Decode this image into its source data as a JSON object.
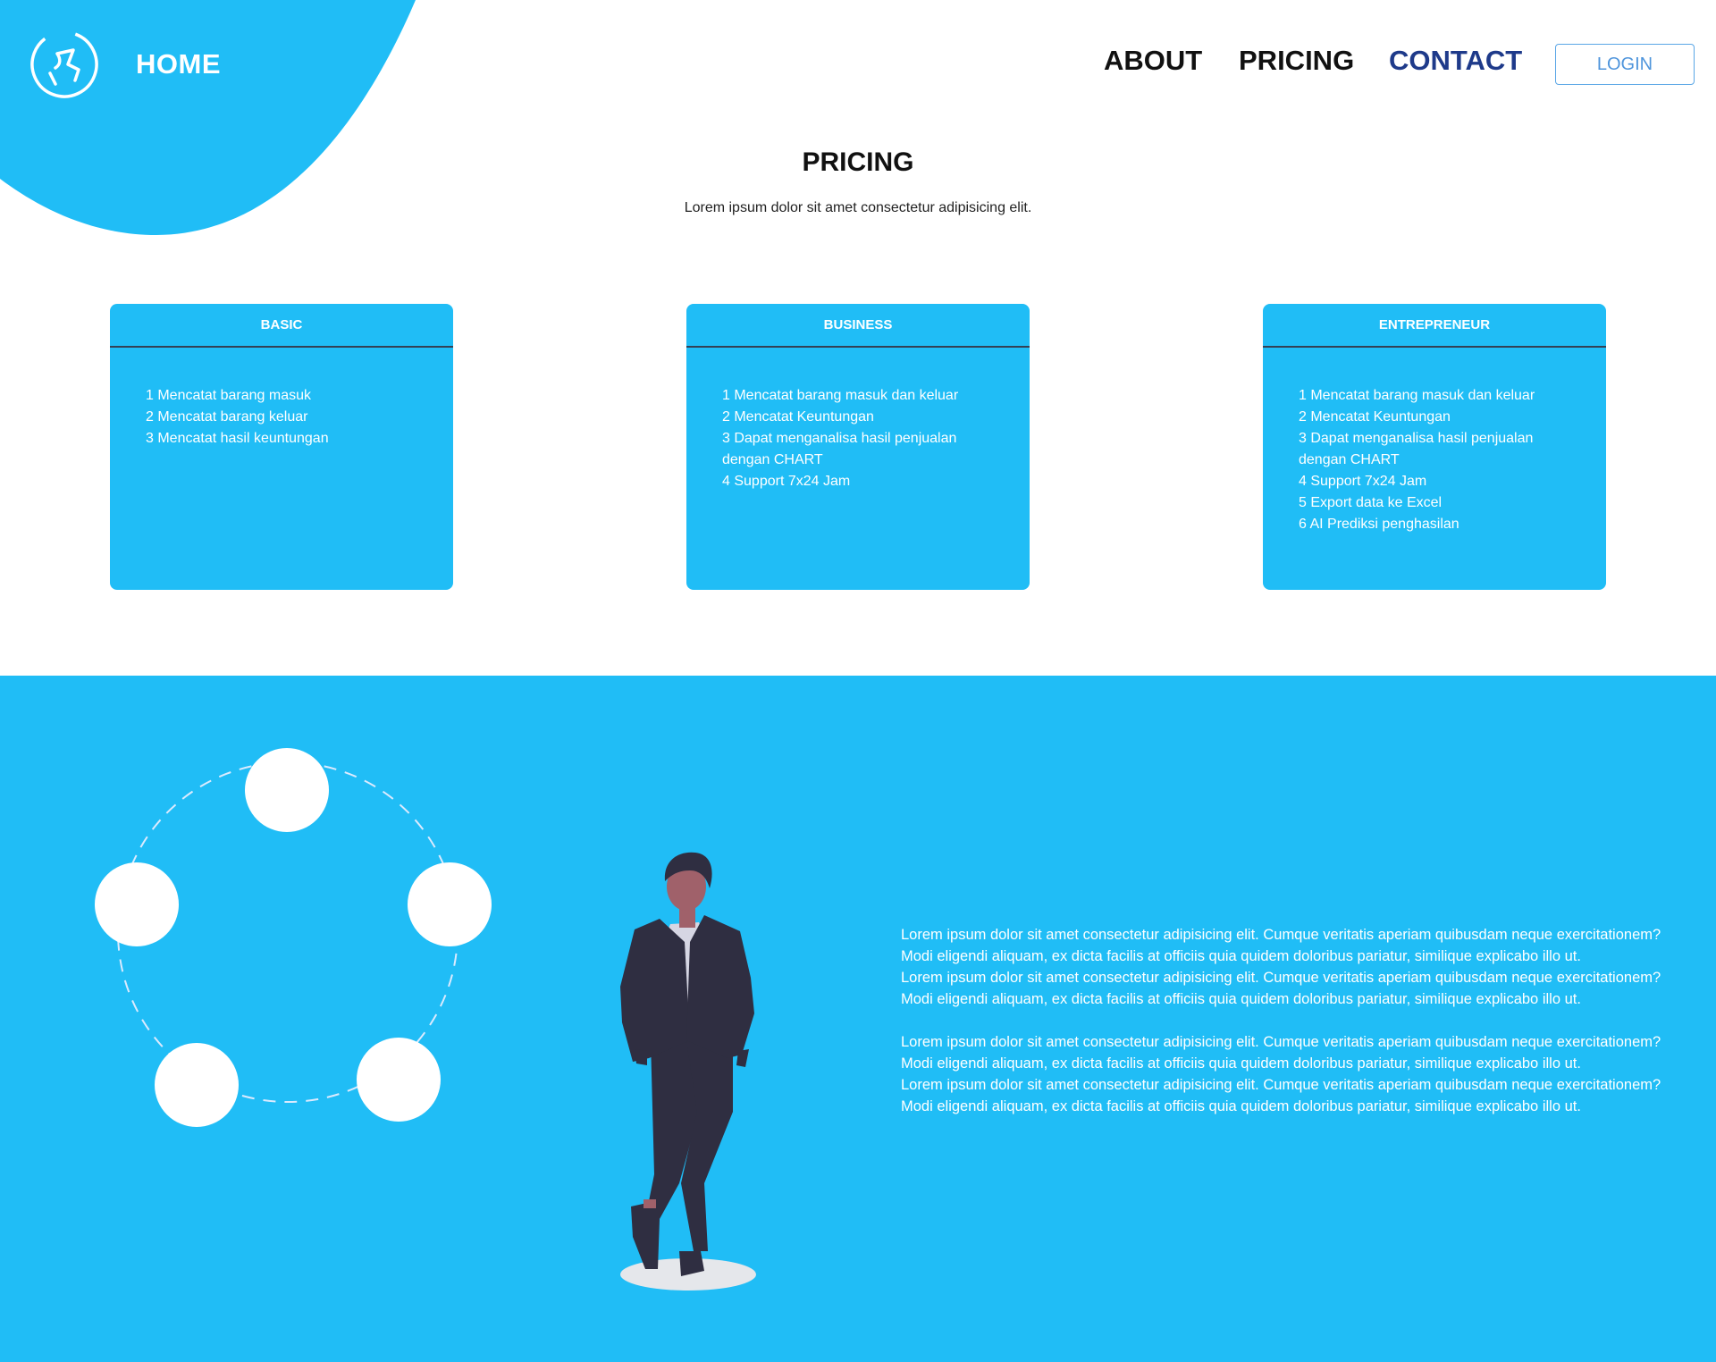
{
  "header": {
    "home_label": "HOME",
    "nav": {
      "about": "ABOUT",
      "pricing": "PRICING",
      "contact": "CONTACT"
    },
    "login_label": "LOGIN"
  },
  "pricing": {
    "title": "PRICING",
    "subtitle": "Lorem ipsum dolor sit amet consectetur adipisicing elit.",
    "plans": [
      {
        "name": "BASIC",
        "features": [
          "1 Mencatat barang masuk",
          "2 Mencatat barang keluar",
          "3 Mencatat hasil keuntungan"
        ]
      },
      {
        "name": "BUSINESS",
        "features": [
          "1 Mencatat barang masuk dan keluar",
          "2 Mencatat Keuntungan",
          "3 Dapat menganalisa hasil penjualan dengan CHART",
          "4 Support 7x24 Jam"
        ]
      },
      {
        "name": "ENTREPRENEUR",
        "features": [
          "1 Mencatat barang masuk dan keluar",
          "2 Mencatat Keuntungan",
          "3 Dapat menganalisa hasil penjualan dengan CHART",
          "4 Support 7x24 Jam",
          "5 Export data ke Excel",
          "6 AI Prediksi penghasilan"
        ]
      }
    ]
  },
  "info": {
    "paragraphs": [
      "Lorem ipsum dolor sit amet consectetur adipisicing elit. Cumque veritatis aperiam quibusdam neque exercitationem? Modi eligendi aliquam, ex dicta facilis at officiis quia quidem doloribus pariatur, similique explicabo illo ut.",
      "Lorem ipsum dolor sit amet consectetur adipisicing elit. Cumque veritatis aperiam quibusdam neque exercitationem? Modi eligendi aliquam, ex dicta facilis at officiis quia quidem doloribus pariatur, similique explicabo illo ut.",
      "Lorem ipsum dolor sit amet consectetur adipisicing elit. Cumque veritatis aperiam quibusdam neque exercitationem? Modi eligendi aliquam, ex dicta facilis at officiis quia quidem doloribus pariatur, similique explicabo illo ut.",
      "Lorem ipsum dolor sit amet consectetur adipisicing elit. Cumque veritatis aperiam quibusdam neque exercitationem? Modi eligendi aliquam, ex dicta facilis at officiis quia quidem doloribus pariatur, similique explicabo illo ut."
    ]
  },
  "icons": {
    "logo": "logo-icon",
    "cycle": "cycle-diagram-illustration",
    "person": "businessman-illustration"
  },
  "colors": {
    "accent": "#20bdf6",
    "nav_active": "#1e3a8a",
    "login_border": "#5aa6e6"
  }
}
